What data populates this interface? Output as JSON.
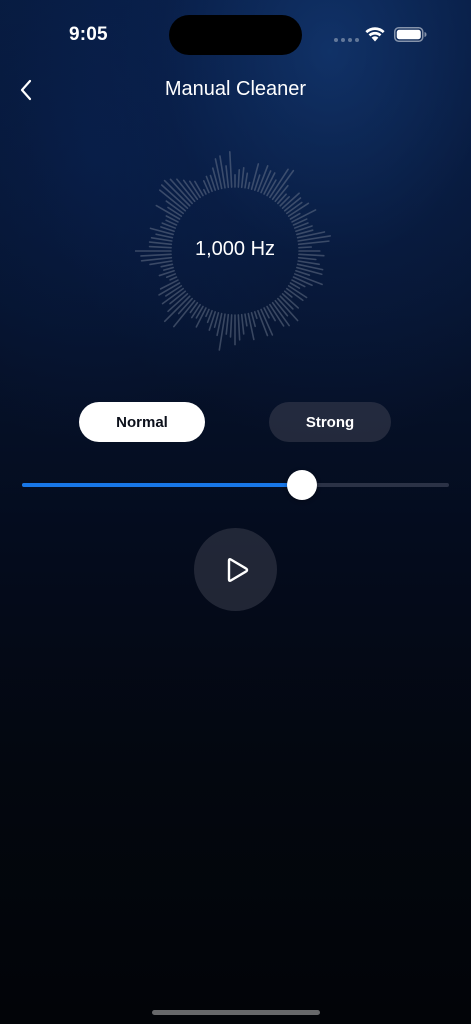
{
  "status_bar": {
    "time": "9:05"
  },
  "header": {
    "title": "Manual Cleaner",
    "back_icon": "chevron-left-icon"
  },
  "visualizer": {
    "frequency": "1,000 Hz"
  },
  "modes": {
    "options": [
      "Normal",
      "Strong"
    ],
    "selected": "Normal"
  },
  "slider": {
    "level_fraction": 0.655
  },
  "controls": {
    "play_icon": "play-icon"
  },
  "colors": {
    "accent": "#1877e8",
    "background_top": "#071a3d",
    "background_bottom": "#020408"
  }
}
